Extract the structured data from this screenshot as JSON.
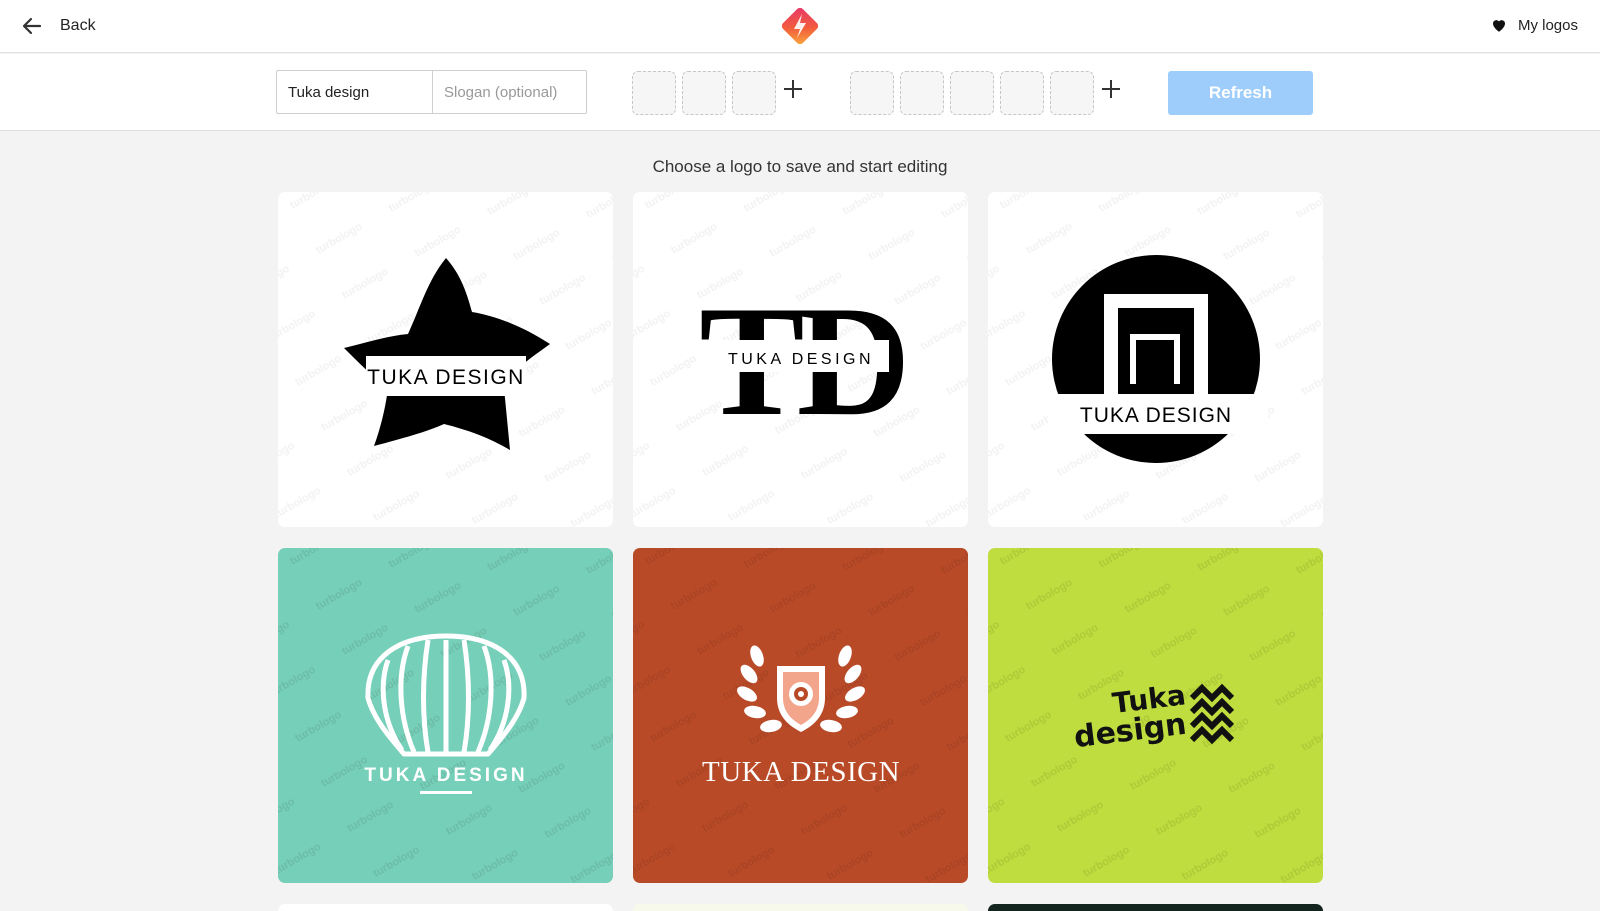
{
  "topbar": {
    "back_label": "Back",
    "my_logos_label": "My logos",
    "icons": [
      "arrow-left-icon",
      "brand-logo",
      "heart-icon"
    ]
  },
  "toolbar": {
    "company_name_value": "Tuka design",
    "slogan_placeholder": "Slogan (optional)",
    "refresh_label": "Refresh",
    "refresh_color": "#9ecdfb"
  },
  "main": {
    "heading": "Choose a logo to save and start editing",
    "watermark": "turbologo",
    "cards": [
      {
        "text": "TUKA DESIGN",
        "monogram": "",
        "background": "#ffffff",
        "icon": "star-icon"
      },
      {
        "text": "TUKA DESIGN",
        "monogram": "TD",
        "background": "#ffffff",
        "icon": "td-monogram"
      },
      {
        "text": "TUKA DESIGN",
        "monogram": "",
        "background": "#ffffff",
        "icon": "circle-frame-icon"
      },
      {
        "text": "TUKA DESIGN",
        "monogram": "",
        "background": "#76cfb8",
        "icon": "seashell-icon"
      },
      {
        "text": "TUKA DESIGN",
        "monogram": "",
        "background": "#b94a28",
        "icon": "laurel-shield-icon"
      },
      {
        "text_line1": "Tuka",
        "text_line2": "design",
        "background": "#bfdd3e",
        "icon": "waves-icon"
      }
    ]
  }
}
